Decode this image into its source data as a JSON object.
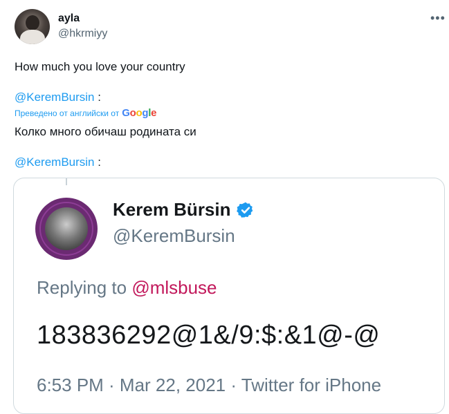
{
  "tweet": {
    "author": {
      "name": "ayla",
      "handle": "@hkrmiyy"
    },
    "more_icon": "more-horizontal-icon",
    "text": "How much you love your country",
    "mention1": "@KeremBursin",
    "mention1_suffix": " :",
    "translation": {
      "label": "Преведено от английски от",
      "provider": "Google"
    },
    "translated_text": "Колко много обичаш родината си",
    "mention2": "@KeremBursin",
    "mention2_suffix": " :"
  },
  "embedded": {
    "name": "Kerem Bürsin",
    "verified_icon": "verified-badge-icon",
    "handle": "@KeremBursin",
    "replying_prefix": "Replying to ",
    "replying_to": "@mlsbuse",
    "text": "183836292@1&/9:$:&1@-@",
    "meta": "6:53 PM · Mar 22, 2021 · Twitter for iPhone"
  },
  "colors": {
    "accent": "#1d9bf0",
    "mention_pink": "#c2185b",
    "badge_purple": "#6b2a72"
  }
}
